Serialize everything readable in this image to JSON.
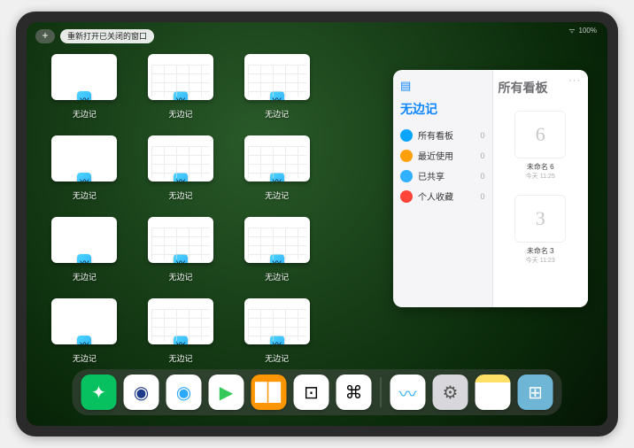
{
  "status": {
    "signal": "ᯤ",
    "battery": "100%"
  },
  "topbar": {
    "plus": "+",
    "reopen_label": "重新打开已关闭的窗口"
  },
  "windows": {
    "app_label": "无边记",
    "items": [
      {
        "variant": "blank"
      },
      {
        "variant": "grid"
      },
      {
        "variant": "grid"
      },
      {
        "variant": "blank"
      },
      {
        "variant": "grid"
      },
      {
        "variant": "grid"
      },
      {
        "variant": "blank"
      },
      {
        "variant": "grid"
      },
      {
        "variant": "grid"
      },
      {
        "variant": "blank"
      },
      {
        "variant": "grid"
      },
      {
        "variant": "grid"
      }
    ]
  },
  "panel": {
    "left_title": "无边记",
    "right_title": "所有看板",
    "categories": [
      {
        "label": "所有看板",
        "count": "0",
        "color": "#0aa5ff"
      },
      {
        "label": "最近使用",
        "count": "0",
        "color": "#ff9f0a"
      },
      {
        "label": "已共享",
        "count": "0",
        "color": "#30b0ff"
      },
      {
        "label": "个人收藏",
        "count": "0",
        "color": "#ff453a"
      }
    ],
    "boards": [
      {
        "sketch": "6",
        "name": "未命名 6",
        "date": "今天 11:25"
      },
      {
        "sketch": "3",
        "name": "未命名 3",
        "date": "今天 11:23"
      }
    ],
    "more": "···"
  },
  "dock": {
    "apps": [
      {
        "name": "wechat",
        "bg": "#07c160",
        "glyph": "✦",
        "glyphColor": "#fff"
      },
      {
        "name": "quark-hd",
        "bg": "#ffffff",
        "glyph": "◉",
        "glyphColor": "#1e3a8a"
      },
      {
        "name": "quark",
        "bg": "#ffffff",
        "glyph": "◉",
        "glyphColor": "#2da8ff"
      },
      {
        "name": "play",
        "bg": "#ffffff",
        "glyph": "▶",
        "glyphColor": "#34c759"
      },
      {
        "name": "books",
        "bg": "#ff9500",
        "glyph": "▉▉",
        "glyphColor": "#fff"
      },
      {
        "name": "dice",
        "bg": "#ffffff",
        "glyph": "⊡",
        "glyphColor": "#000"
      },
      {
        "name": "omni",
        "bg": "#ffffff",
        "glyph": "⌘",
        "glyphColor": "#000"
      }
    ],
    "recent": [
      {
        "name": "freeform",
        "bg": "#ffffff",
        "glyph": "〰",
        "glyphColor": "#30b0ff"
      },
      {
        "name": "settings",
        "bg": "#d8d8dc",
        "glyph": "⚙",
        "glyphColor": "#555"
      },
      {
        "name": "notes",
        "bg": "linear-gradient(#ffe066 22%, #ffffff 22%)",
        "glyph": "",
        "glyphColor": ""
      },
      {
        "name": "app-library",
        "bg": "#6fb5d6",
        "glyph": "⊞",
        "glyphColor": "#fff"
      }
    ]
  }
}
